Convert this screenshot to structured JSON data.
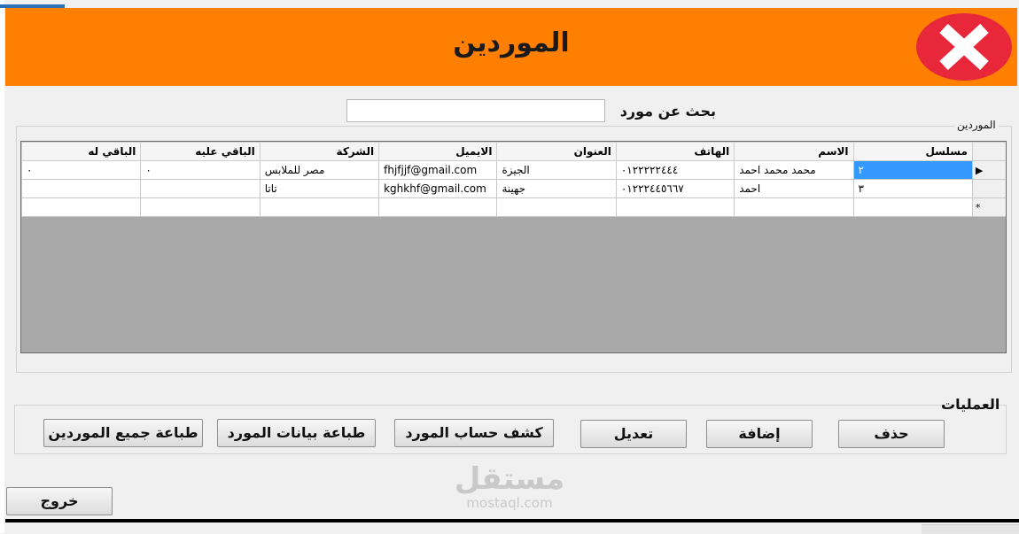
{
  "window": {
    "title": "الموردين"
  },
  "search": {
    "label": "بحث عن مورد",
    "value": ""
  },
  "suppliers_group": {
    "label": "الموردين"
  },
  "grid": {
    "columns": [
      "مسلسل",
      "الاسم",
      "الهاتف",
      "العنوان",
      "الايميل",
      "الشركة",
      "الباقي عليه",
      "الباقي له"
    ],
    "rows": [
      {
        "indicator": "▶",
        "cells": [
          "٢",
          "محمد محمد احمد",
          "٠١٢٢٢٢٢٤٤٤",
          "الجيزة",
          "fhjfjjf@gmail.com",
          "مصر للملابس",
          "٠",
          "٠"
        ],
        "selected": true
      },
      {
        "indicator": "",
        "cells": [
          "٣",
          "احمد",
          "٠١٢٢٢٤٤٥٦٦٧",
          "جهينة",
          "kghkhf@gmail.com",
          "تاتا",
          "",
          ""
        ]
      },
      {
        "indicator": "*",
        "cells": [
          "",
          "",
          "",
          "",
          "",
          "",
          "",
          ""
        ]
      }
    ]
  },
  "operations": {
    "label": "العمليات",
    "delete_label": "حذف",
    "add_label": "إضافة",
    "edit_label": "تعديل",
    "statement_label": "كشف حساب المورد",
    "print_supplier_label": "طباعة بيانات المورد",
    "print_all_label": "طباعة جميع الموردين"
  },
  "exit_label": "خروج",
  "watermark": {
    "brand": "مستقل",
    "domain": "mostaql.com"
  },
  "colors": {
    "header": "#ff8000",
    "close": "#e8283a",
    "selection": "#3399ff",
    "grid_empty": "#a9a9a9"
  }
}
